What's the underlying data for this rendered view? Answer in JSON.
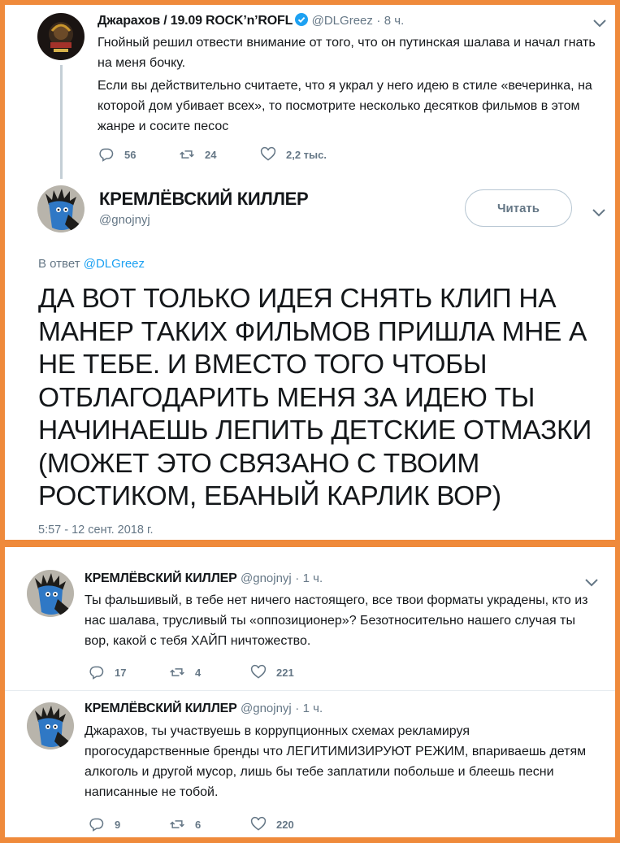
{
  "tweet1": {
    "name": "Джарахов / 19.09 ROCK’n’ROFL",
    "handle": "@DLGreez",
    "dot": "·",
    "time": "8 ч.",
    "line1": "Гнойный решил отвести внимание от того, что он путинская шалава и начал гнать на меня бочку.",
    "line2": "Если вы действительно считаете, что я украл у него идею в стиле «вечеринка, на которой дом убивает всех», то посмотрите несколько десятков фильмов в этом жанре и сосите песос",
    "replies": "56",
    "retweets": "24",
    "likes": "2,2 тыс."
  },
  "main_tweet": {
    "name": "КРЕМЛЁВСКИЙ КИЛЛЕР",
    "handle": "@gnojnyj",
    "follow_label": "Читать",
    "reply_prefix": "В ответ",
    "reply_handle": "@DLGreez",
    "text": "ДА ВОТ ТОЛЬКО ИДЕЯ СНЯТЬ КЛИП НА МАНЕР ТАКИХ ФИЛЬМОВ ПРИШЛА МНЕ А НЕ ТЕБЕ. И ВМЕСТО ТОГО ЧТОБЫ ОТБЛАГОДАРИТЬ МЕНЯ ЗА ИДЕЮ ТЫ НАЧИНАЕШЬ ЛЕПИТЬ ДЕТСКИЕ ОТМАЗКИ (МОЖЕТ ЭТО СВЯЗАНО С ТВОИМ РОСТИКОМ, ЕБАНЫЙ КАРЛИК ВОР)",
    "date": "5:57 - 12 сент. 2018 г."
  },
  "tweet2": {
    "name": "КРЕМЛЁВСКИЙ КИЛЛЕР",
    "handle": "@gnojnyj",
    "dot": "·",
    "time": "1 ч.",
    "text": "Ты фальшивый, в тебе нет ничего настоящего, все твои форматы украдены, кто из нас шалава, трусливый ты «оппозиционер»?  Безотносительно нашего случая ты вор, какой с тебя ХАЙП ничтожество.",
    "replies": "17",
    "retweets": "4",
    "likes": "221"
  },
  "tweet3": {
    "name": "КРЕМЛЁВСКИЙ КИЛЛЕР",
    "handle": "@gnojnyj",
    "dot": "·",
    "time": "1 ч.",
    "text": "Джарахов, ты участвуешь в коррупционных схемах рекламируя прогосударственные бренды что ЛЕГИТИМИЗИРУЮТ РЕЖИМ, впариваешь детям алкоголь и другой мусор, лишь бы тебе заплатили побольше и блеешь песни написанные не тобой.",
    "replies": "9",
    "retweets": "6",
    "likes": "220"
  },
  "colors": {
    "frame": "#ef8a3b",
    "link": "#1da1f2",
    "muted": "#657786",
    "verified": "#1da1f2"
  }
}
